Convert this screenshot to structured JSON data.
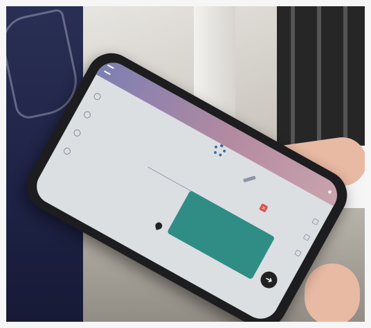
{
  "photo": {
    "phone_brand_colors": {
      "topbar_start": "#7d7fb3",
      "topbar_end": "#c9a3ad",
      "accent_button": "#2f8d86",
      "close_badge": "#d9534f"
    }
  },
  "app": {
    "topbar": {
      "title": "",
      "menu_icon": "menu-icon"
    },
    "list": {
      "items": [
        {
          "icon": "radio-icon",
          "label": ""
        },
        {
          "icon": "radio-icon",
          "label": ""
        },
        {
          "icon": "radio-icon",
          "label": ""
        },
        {
          "icon": "radio-icon",
          "label": ""
        }
      ]
    },
    "icons": {
      "settings": "gear-icon",
      "edit": "pencil-icon",
      "close": "close-icon",
      "location": "location-pin-icon",
      "next": "arrow-right-icon"
    },
    "field": {
      "value": ""
    },
    "primary_button": {
      "label": ""
    },
    "fab": {
      "glyph": "➜"
    },
    "close_badge": {
      "glyph": "×"
    }
  }
}
